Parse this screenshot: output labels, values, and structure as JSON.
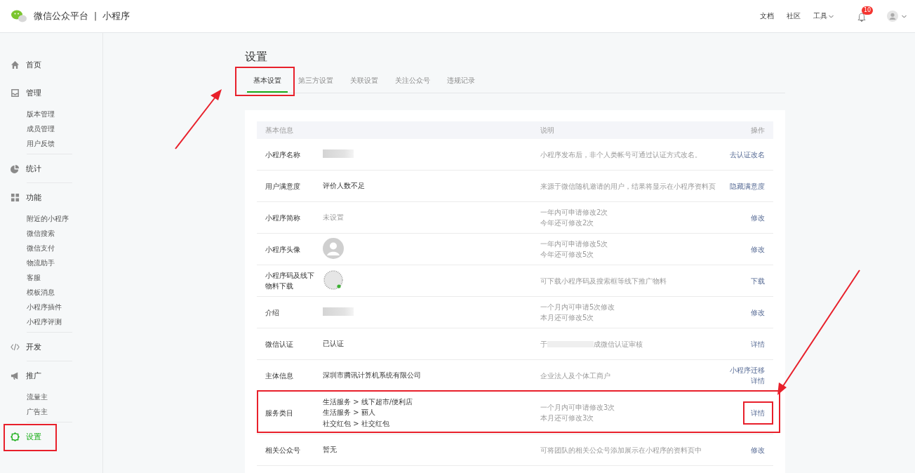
{
  "header": {
    "brand": "微信公众平台",
    "separator": "|",
    "product": "小程序",
    "links": [
      {
        "label": "文档",
        "dropdown": false
      },
      {
        "label": "社区",
        "dropdown": false
      },
      {
        "label": "工具",
        "dropdown": true
      }
    ],
    "notifications": {
      "count": "10"
    }
  },
  "sidebar": {
    "items": [
      {
        "label": "首页",
        "selected": false
      },
      {
        "label": "管理",
        "selected": false,
        "children": [
          {
            "label": "版本管理",
            "selected": false
          },
          {
            "label": "成员管理",
            "selected": false
          },
          {
            "label": "用户反馈",
            "selected": false
          }
        ]
      },
      {
        "label": "统计",
        "selected": false
      },
      {
        "label": "功能",
        "selected": false,
        "children": [
          {
            "label": "附近的小程序",
            "selected": false
          },
          {
            "label": "微信搜索",
            "selected": false
          },
          {
            "label": "微信支付",
            "selected": false
          },
          {
            "label": "物流助手",
            "selected": false
          },
          {
            "label": "客服",
            "selected": false
          },
          {
            "label": "模板消息",
            "selected": false
          },
          {
            "label": "小程序插件",
            "selected": false
          },
          {
            "label": "小程序评测",
            "selected": false
          }
        ]
      },
      {
        "label": "开发",
        "selected": false
      },
      {
        "label": "推广",
        "selected": false,
        "children": [
          {
            "label": "流量主",
            "selected": false
          },
          {
            "label": "广告主",
            "selected": false
          }
        ]
      },
      {
        "label": "设置",
        "selected": true
      }
    ]
  },
  "page": {
    "title": "设置"
  },
  "tabs": [
    {
      "label": "基本设置",
      "selected": true
    },
    {
      "label": "第三方设置",
      "selected": false
    },
    {
      "label": "关联设置",
      "selected": false
    },
    {
      "label": "关注公众号",
      "selected": false
    },
    {
      "label": "违规记录",
      "selected": false
    }
  ],
  "table": {
    "columns": [
      "基本信息",
      "说明",
      "操作"
    ],
    "rows": [
      {
        "label": "小程序名称",
        "value": {
          "kind": "redacted"
        },
        "description": [
          "小程序发布后，非个人类帐号可通过认证方式改名。"
        ],
        "actions": [
          "去认证改名"
        ]
      },
      {
        "label": "用户满意度",
        "value": {
          "kind": "text",
          "text": "评价人数不足"
        },
        "description": [
          "来源于微信随机邀请的用户，结果将显示在小程序资料页"
        ],
        "actions": [
          "隐藏满意度"
        ]
      },
      {
        "label": "小程序简称",
        "value": {
          "kind": "muted",
          "text": "未设置"
        },
        "description": [
          "一年内可申请修改2次",
          "今年还可修改2次"
        ],
        "actions": [
          "修改"
        ]
      },
      {
        "label": "小程序头像",
        "value": {
          "kind": "avatar"
        },
        "description": [
          "一年内可申请修改5次",
          "今年还可修改5次"
        ],
        "actions": [
          "修改"
        ]
      },
      {
        "label": "小程序码及线下物料下载",
        "value": {
          "kind": "code"
        },
        "description": [
          "可下载小程序码及搜索框等线下推广物料"
        ],
        "actions": [
          "下载"
        ]
      },
      {
        "label": "介绍",
        "value": {
          "kind": "redacted"
        },
        "description": [
          "一个月内可申请5次修改",
          "本月还可修改5次"
        ],
        "actions": [
          "修改"
        ]
      },
      {
        "label": "微信认证",
        "value": {
          "kind": "text",
          "text": "已认证"
        },
        "description": [
          {
            "segments": [
              {
                "kind": "text",
                "text": "于"
              },
              {
                "kind": "redacted"
              },
              {
                "kind": "text",
                "text": "成微信认证审核"
              }
            ]
          }
        ],
        "actions": [
          "详情"
        ]
      },
      {
        "label": "主体信息",
        "value": {
          "kind": "text",
          "text": "深圳市腾讯计算机系统有限公司"
        },
        "description": [
          "企业法人及个体工商户"
        ],
        "actions": [
          "小程序迁移",
          "详情"
        ]
      },
      {
        "label": "服务类目",
        "value": {
          "kind": "lines",
          "lines": [
            "生活服务 > 线下超市/便利店",
            "生活服务 > 丽人",
            "社交红包 > 社交红包"
          ]
        },
        "description": [
          "一个月内可申请修改3次",
          "本月还可修改3次"
        ],
        "actions": [
          "详情"
        ]
      },
      {
        "label": "相关公众号",
        "value": {
          "kind": "text",
          "text": "暂无"
        },
        "description": [
          "可将团队的相关公众号添加展示在小程序的资料页中"
        ],
        "actions": [
          "修改"
        ]
      }
    ]
  }
}
